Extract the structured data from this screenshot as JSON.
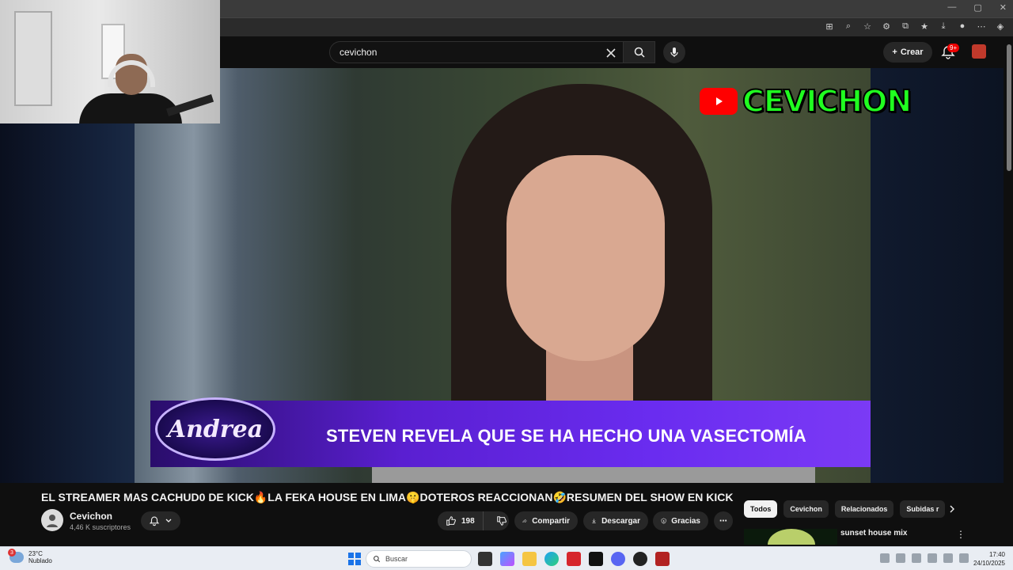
{
  "youtube": {
    "search": {
      "value": "cevichon"
    },
    "create_label": "Crear",
    "notif_badge": "9+"
  },
  "video": {
    "watermark": "CEVICHON",
    "banner_logo": "Andrea",
    "banner_text": "STEVEN REVELA QUE SE HA HECHO UNA VASECTOMÍA",
    "title": "EL STREAMER MAS CACHUD0 DE KICK🔥LA FEKA HOUSE EN LIMA🤫DOTEROS REACCIONAN🤣RESUMEN DEL SHOW EN KICK"
  },
  "channel": {
    "name": "Cevichon",
    "subscribers": "4,46 K suscriptores"
  },
  "actions": {
    "like_count": "198",
    "share": "Compartir",
    "download": "Descargar",
    "thanks": "Gracias"
  },
  "filters": [
    "Todos",
    "Cevichon",
    "Relacionados",
    "Subidas r"
  ],
  "recommendation": {
    "title": "sunset house mix"
  },
  "taskbar": {
    "weather_badge": "3",
    "temp": "23°C",
    "condition": "Nublado",
    "search_placeholder": "Buscar",
    "time": "17:40",
    "date": "24/10/2025"
  },
  "colors": {
    "accent_red": "#ff0000",
    "watermark_green": "#20ff20",
    "banner_purple": "#6a2cf0"
  }
}
